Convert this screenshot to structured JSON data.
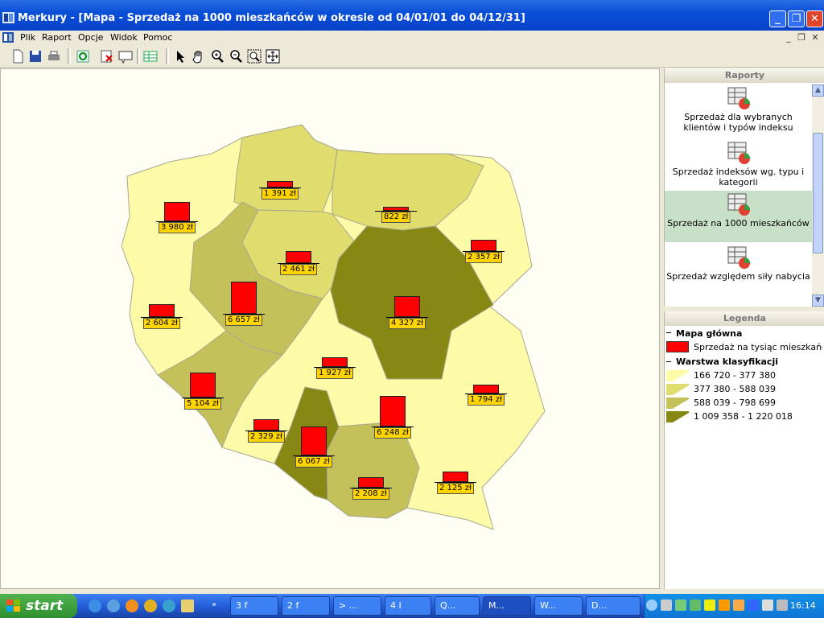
{
  "window": {
    "title": "Merkury - [Mapa - Sprzedaż na 1000 mieszkańców w okresie od 04/01/01 do 04/12/31]"
  },
  "menu": [
    "Plik",
    "Raport",
    "Opcje",
    "Widok",
    "Pomoc"
  ],
  "map": {
    "region_colors": {
      "light": "#fdfaa8",
      "medium": "#e0dc6d",
      "darker": "#c4c05a",
      "dark": "#878814"
    },
    "values": [
      {
        "label": "3 980 zł",
        "value": 3980
      },
      {
        "label": "1 391 zł",
        "value": 1391
      },
      {
        "label": "822 zł",
        "value": 822
      },
      {
        "label": "2 461 zł",
        "value": 2461
      },
      {
        "label": "2 357 zł",
        "value": 2357
      },
      {
        "label": "2 604 zł",
        "value": 2604
      },
      {
        "label": "6 657 zł",
        "value": 6657
      },
      {
        "label": "4 327 zł",
        "value": 4327
      },
      {
        "label": "1 927 zł",
        "value": 1927
      },
      {
        "label": "5 104 zł",
        "value": 5104
      },
      {
        "label": "1 794 zł",
        "value": 1794
      },
      {
        "label": "2 329 zł",
        "value": 2329
      },
      {
        "label": "6 248 zł",
        "value": 6248
      },
      {
        "label": "6 067 zł",
        "value": 6067
      },
      {
        "label": "2 125 zł",
        "value": 2125
      },
      {
        "label": "2 208 zł",
        "value": 2208
      }
    ],
    "bar_color": "#ff0000",
    "label_color": "#ffd400"
  },
  "reports": {
    "header": "Raporty",
    "items": [
      {
        "label": "Sprzedaż dla wybranych klientów i typów indeksu",
        "selected": false
      },
      {
        "label": "Sprzedaż indeksów wg. typu i kategorii",
        "selected": false
      },
      {
        "label": "Sprzedaż na 1000 mieszkańców",
        "selected": true
      },
      {
        "label": "Sprzedaż względem siły nabycia",
        "selected": false
      }
    ]
  },
  "legend": {
    "header": "Legenda",
    "main_section": "Mapa główna",
    "main_item": "Sprzedaż na tysiąc mieszkańców",
    "class_section": "Warstwa klasyfikacji",
    "classes": [
      {
        "range": "166 720 - 377 380",
        "color": "#fdfaa8"
      },
      {
        "range": "377 380 - 588 039",
        "color": "#e0dc6d"
      },
      {
        "range": "588 039 - 798 699",
        "color": "#c4c05a"
      },
      {
        "range": "1 009 358 - 1 220 018",
        "color": "#878814"
      }
    ]
  },
  "taskbar": {
    "start": "start",
    "tasks": [
      "3 f",
      "2 f",
      "> ...",
      "4 I",
      "Q...",
      "M...",
      "W...",
      "D..."
    ],
    "clock": "16:14"
  }
}
